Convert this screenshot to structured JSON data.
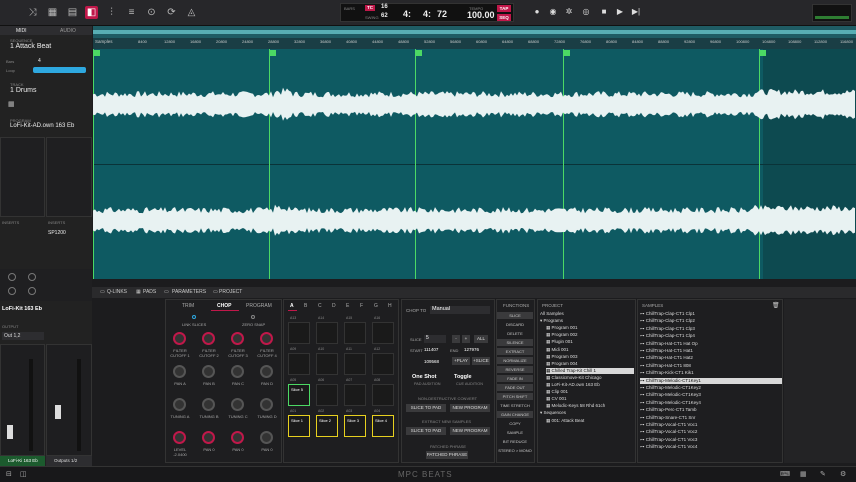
{
  "topbar": {
    "icons": [
      "shuffle",
      "grid",
      "sampler",
      "browser",
      "mixer",
      "menu",
      "record",
      "loop",
      "metronome"
    ],
    "bars_label": "BARS",
    "tc_label": "TC",
    "tc_value": "16",
    "swing_label": "SWING",
    "swing_value": "62",
    "bar": "4:",
    "beat": "4:",
    "tick": "72",
    "tempo_label": "TEMPO",
    "tempo": "100.00",
    "tap": "TAP",
    "seq_mode": "SEQ"
  },
  "left": {
    "mode_tabs": [
      "MIDI",
      "AUDIO"
    ],
    "sequence_label": "SEQUENCE",
    "sequence_name": "1 Attack Beat",
    "bars_label": "Bars",
    "bars_value": "4",
    "loop_label": "Loop",
    "track_label": "TRACK",
    "track_name": "1 Drums",
    "program_label": "PROGRAM",
    "program_name": "LoFi-Kit-AD.own 163 Eb",
    "inserts_label": "INSERTS",
    "inserts2_label": "INSERTS",
    "insert_fx": "SP1200",
    "program_short": "LoFi-Kit 163 Eb",
    "output_label": "OUTPUT",
    "output_value": "Out 1,2",
    "chan1": "LoFi-Ki 163 Eb",
    "chan2": "Outputs 1/2"
  },
  "ruler": {
    "samples_label": "Samples",
    "ticks": [
      "8400",
      "12800",
      "16800",
      "20800",
      "24800",
      "28800",
      "32800",
      "36800",
      "40800",
      "44800",
      "48800",
      "52800",
      "56800",
      "60800",
      "64800",
      "68800",
      "72800",
      "76800",
      "80800",
      "84800",
      "88800",
      "92800",
      "96800",
      "100800",
      "104800",
      "108800",
      "112800",
      "116800",
      "120800"
    ]
  },
  "tabs": [
    "Q-LINKS",
    "PADS",
    "PARAMETERS",
    "PROJECT"
  ],
  "sampler": {
    "modes": [
      "TRIM",
      "CHOP",
      "PROGRAM"
    ],
    "link_slices": "LINK SLICES",
    "zero_snap": "ZERO SNAP",
    "knob_rows": [
      [
        "FILTER CUTOFF 1",
        "FILTER CUTOFF 2",
        "FILTER CUTOFF 3",
        "FILTER CUTOFF 4"
      ],
      [
        "PAN A",
        "PAN B",
        "PAN C",
        "PAN D"
      ],
      [
        "TUNING A",
        "TUNING B",
        "TUNING C",
        "TUNING D"
      ],
      [
        "LEVEL -2.0400",
        "PAN 0",
        "PAN 0",
        "PAN 0"
      ]
    ]
  },
  "pads": {
    "banks": [
      "A",
      "B",
      "C",
      "D",
      "E",
      "F",
      "G",
      "H"
    ],
    "row_labels": [
      "A13",
      "A14",
      "A15",
      "A16",
      "A09",
      "A10",
      "A11",
      "A12",
      "A05",
      "A06",
      "A07",
      "A08",
      "A01",
      "A02",
      "A03",
      "A04"
    ],
    "slices": [
      "Slice 5",
      "Slice 1",
      "Slice 2",
      "Slice 3",
      "Slice 4"
    ]
  },
  "chop": {
    "chop_to_label": "CHOP TO",
    "chop_to_value": "Manual",
    "slice_label": "SLICE",
    "slice_value": "5",
    "all": "ALL",
    "start_label": "START",
    "start_value": "111407",
    "end_label": "END",
    "end_value": "127976",
    "length_value": "109568",
    "play": "+PLAY",
    "add_slice": "+SLICE",
    "pad_audition_value": "One Shot",
    "pad_audition_label": "PAD AUDITION",
    "cue_value": "Toggle",
    "cue_label": "CUE AUDITION",
    "nondestructive": "NON-DESTRUCTIVE CONVERT",
    "slice_to_pad": "SLICE TO PAD",
    "new_program": "NEW PROGRAM",
    "extract_label": "EXTRACT NEW SAMPLES",
    "slice_to_pad2": "SLICE TO PAD",
    "new_program2": "NEW PROGRAM",
    "patched_label": "PATCHED PHRASE",
    "patched_btn": "PATCHED PHRASE"
  },
  "functions": {
    "title": "FUNCTIONS",
    "items": [
      "SLICE",
      "DISCARD",
      "DELETE",
      "SILENCE",
      "EXTRACT",
      "NORMALIZE",
      "REVERSE",
      "FADE IN",
      "FADE OUT",
      "PITCH SHIFT",
      "TIME STRETCH",
      "GAIN CHANGE",
      "COPY",
      "SAMPLE",
      "BIT REDUCE",
      "STEREO > MONO"
    ]
  },
  "project": {
    "title": "PROJECT",
    "items": [
      "All Samples",
      "Programs",
      "Program 001",
      "Program 002",
      "Plugin 001",
      "Midi 001",
      "Program 003",
      "Program 004",
      "Chilled Trap-Kit Chill 1",
      "Classicmove-Kit Chicago",
      "LoFi-Kit-AD.own 163 Eb",
      "Clip 001",
      "CV 001",
      "Melodic-Keys 58 Rhd 61ch",
      "Sequences",
      "001: Attack Beat"
    ]
  },
  "samples": {
    "title": "SAMPLES",
    "items": [
      "ChillTrap-Clap-CT1 Clp1",
      "ChillTrap-Clap-CT1 Clp2",
      "ChillTrap-Clap-CT1 Clp3",
      "ChillTrap-Clap-CT1 Clp4",
      "ChillTrap-Hat-CT1 Hat Op",
      "ChillTrap-Hat-CT1 Hat1",
      "ChillTrap-Hat-CT1 Hat2",
      "ChillTrap-Hat-CT1 808",
      "ChillTrap-Kick-CT1 Kik1",
      "ChillTrap-Melodic-CT1Key1",
      "ChillTrap-Melodic-CT1Key2",
      "ChillTrap-Melodic-CT1Key3",
      "ChillTrap-Melodic-CT1Key4",
      "ChillTrap-Perc-CT1 Tamb",
      "ChillTrap-Snare-CT1 Snr",
      "ChillTrap-Vocal-CT1 Voc1",
      "ChillTrap-Vocal-CT1 Voc2",
      "ChillTrap-Vocal-CT1 Voc3",
      "ChillTrap-Vocal-CT1 Voc4"
    ]
  },
  "statusbar": {
    "brand": "MPC BEATS"
  }
}
